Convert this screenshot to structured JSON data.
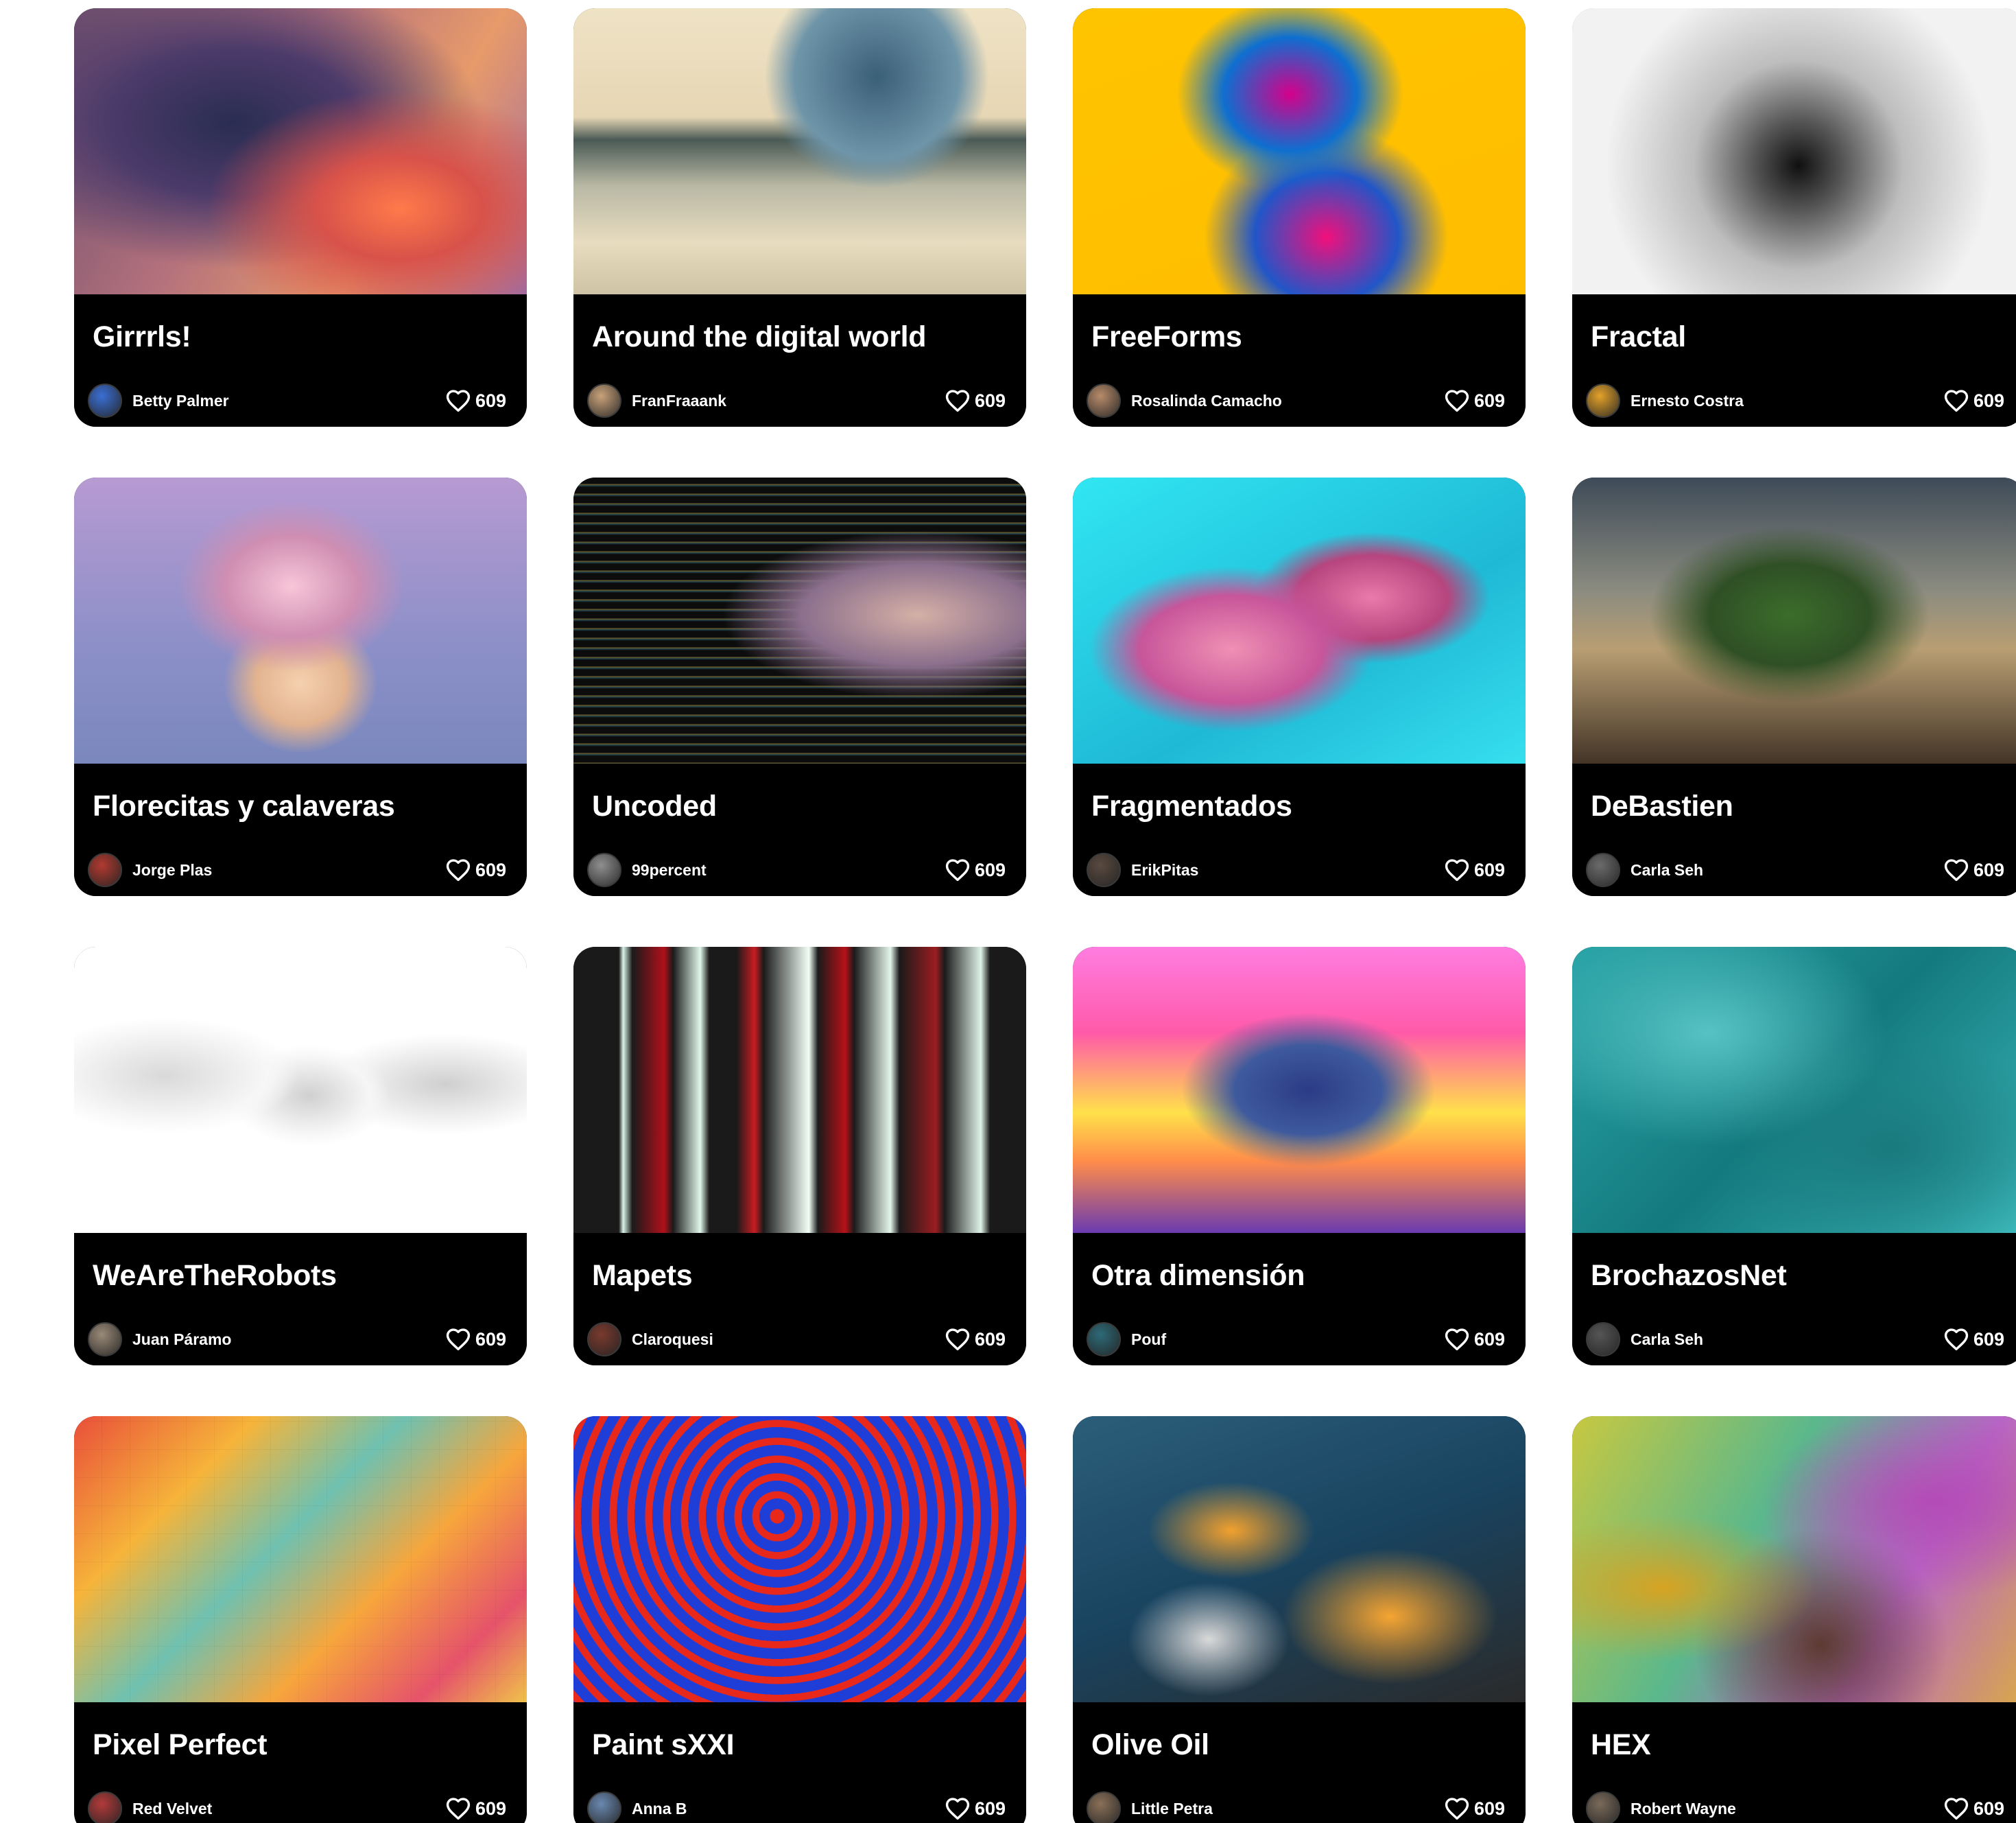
{
  "cards": [
    {
      "title": "Girrrls!",
      "author": "Betty Palmer",
      "likes": "609",
      "thumbnail_icon": "abstract-swirl-artwork",
      "avatar_color": "#3b6fd4"
    },
    {
      "title": "Around the digital world",
      "author": "FranFraaank",
      "likes": "609",
      "thumbnail_icon": "sphere-landscape-artwork",
      "avatar_color": "#c9a27a"
    },
    {
      "title": "FreeForms",
      "author": "Rosalinda Camacho",
      "likes": "609",
      "thumbnail_icon": "3d-shape-artwork",
      "avatar_color": "#b78b6a"
    },
    {
      "title": "Fractal",
      "author": "Ernesto Costra",
      "likes": "609",
      "thumbnail_icon": "fractal-artwork",
      "avatar_color": "#e3a22a"
    },
    {
      "title": "Florecitas y calaveras",
      "author": "Jorge Plas",
      "likes": "609",
      "thumbnail_icon": "pink-cloth-artwork",
      "avatar_color": "#b13a30"
    },
    {
      "title": "Uncoded",
      "author": "99percent",
      "likes": "609",
      "thumbnail_icon": "code-face-artwork",
      "avatar_color": "#8f8f8f"
    },
    {
      "title": "Fragmentados",
      "author": "ErikPitas",
      "likes": "609",
      "thumbnail_icon": "face-fragments-artwork",
      "avatar_color": "#5a4a40"
    },
    {
      "title": "DeBastien",
      "author": "Carla Seh",
      "likes": "609",
      "thumbnail_icon": "floating-island-artwork",
      "avatar_color": "#6b6b6b"
    },
    {
      "title": "WeAreTheRobots",
      "author": "Juan Páramo",
      "likes": "609",
      "thumbnail_icon": "robot-sketch-artwork",
      "avatar_color": "#9a8a78"
    },
    {
      "title": "Mapets",
      "author": "Claroquesi",
      "likes": "609",
      "thumbnail_icon": "neon-lights-artwork",
      "avatar_color": "#7a3a2e"
    },
    {
      "title": "Otra dimensión",
      "author": "Pouf",
      "likes": "609",
      "thumbnail_icon": "retro-head-artwork",
      "avatar_color": "#2d6a78"
    },
    {
      "title": "BrochazosNet",
      "author": "Carla Seh",
      "likes": "609",
      "thumbnail_icon": "teal-brushstroke-artwork",
      "avatar_color": "#555555"
    },
    {
      "title": "Pixel Perfect",
      "author": "Red Velvet",
      "likes": "609",
      "thumbnail_icon": "pixel-mosaic-artwork",
      "avatar_color": "#b23a3a"
    },
    {
      "title": "Paint sXXI",
      "author": "Anna B",
      "likes": "609",
      "thumbnail_icon": "red-blue-pattern-artwork",
      "avatar_color": "#6a88b0"
    },
    {
      "title": "Olive Oil",
      "author": "Little Petra",
      "likes": "609",
      "thumbnail_icon": "marble-swirl-artwork",
      "avatar_color": "#8a7058"
    },
    {
      "title": "HEX",
      "author": "Robert Wayne",
      "likes": "609",
      "thumbnail_icon": "hexagon-texture-artwork",
      "avatar_color": "#7a6a5a"
    }
  ]
}
